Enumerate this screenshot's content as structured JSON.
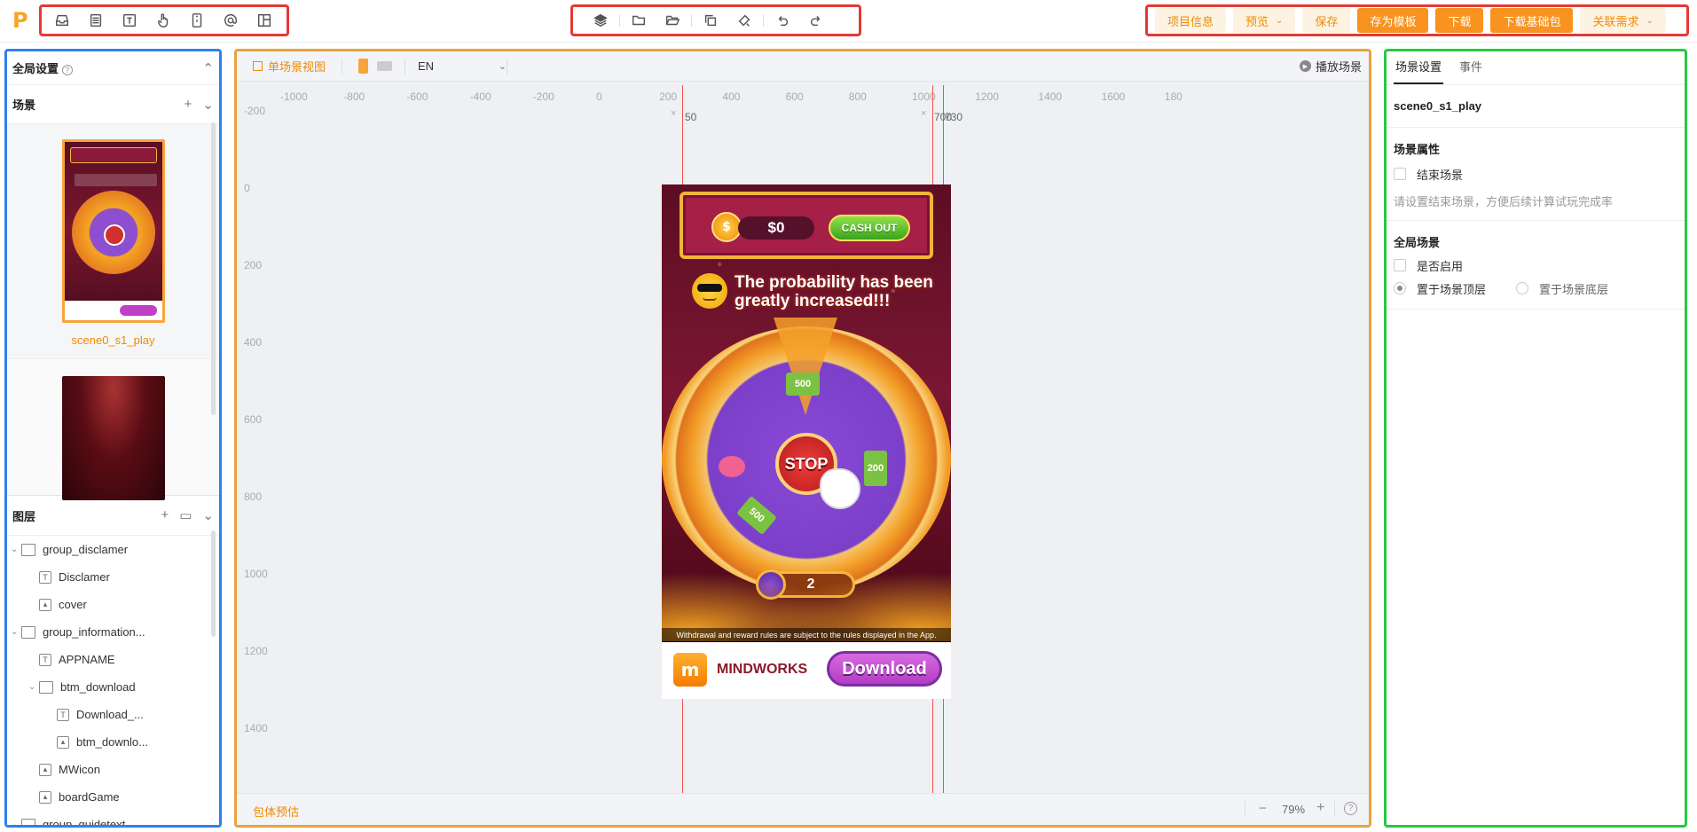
{
  "toolbar": {
    "left_icons": [
      "inbox-icon",
      "list-icon",
      "text-icon",
      "hand-pointer-icon",
      "phone-icon",
      "at-sign-icon",
      "layout-icon"
    ],
    "center_icons": [
      "layers-icon",
      "folder-icon",
      "folder-open-icon",
      "copy-icon",
      "paint-icon",
      "undo-icon",
      "redo-icon"
    ],
    "buttons": {
      "project_info": "项目信息",
      "preview": "预览",
      "save": "保存",
      "save_template": "存为模板",
      "download": "下载",
      "download_base": "下载基础包",
      "related": "关联需求"
    }
  },
  "left_panel": {
    "global_settings": "全局设置",
    "scenes_title": "场景",
    "scenes": [
      {
        "name": "scene0_s1_play",
        "selected": true
      },
      {
        "name": "",
        "selected": false
      }
    ],
    "layers_title": "图层",
    "layers": [
      {
        "name": "group_disclamer",
        "type": "folder",
        "depth": 0
      },
      {
        "name": "Disclamer",
        "type": "text",
        "depth": 1
      },
      {
        "name": "cover",
        "type": "image",
        "depth": 1
      },
      {
        "name": "group_information...",
        "type": "folder",
        "depth": 0
      },
      {
        "name": "APPNAME",
        "type": "text",
        "depth": 1
      },
      {
        "name": "btm_download",
        "type": "folder",
        "depth": 1
      },
      {
        "name": "Download_...",
        "type": "text",
        "depth": 2
      },
      {
        "name": "btm_downlo...",
        "type": "image",
        "depth": 2
      },
      {
        "name": "MWicon",
        "type": "image",
        "depth": 1
      },
      {
        "name": "boardGame",
        "type": "image",
        "depth": 1
      },
      {
        "name": "group_guidetext",
        "type": "folder",
        "depth": 0
      }
    ]
  },
  "canvas": {
    "view_label": "单场景视图",
    "language": "EN",
    "play_scene": "播放场景",
    "ruler_x": [
      "-1000",
      "-800",
      "-600",
      "-400",
      "-200",
      "0",
      "200",
      "400",
      "600",
      "800",
      "1000",
      "1200",
      "1400",
      "1600",
      "180"
    ],
    "ruler_y": [
      "-200",
      "0",
      "200",
      "400",
      "600",
      "800",
      "1000",
      "1200",
      "1400"
    ],
    "guide_labels": [
      "50",
      "700",
      "730"
    ],
    "package_estimate": "包体预估",
    "zoom": "79%",
    "zoom_minus": "−",
    "zoom_plus": "+",
    "help": "?"
  },
  "game": {
    "balance": "$0",
    "cash_out": "CASH OUT",
    "headline": "The probability has been greatly increased!!!",
    "stop": "STOP",
    "spins": "2",
    "disclaimer": "Withdrawal and reward rules are subject to the rules displayed in the App.",
    "app_name": "MINDWORKS",
    "download": "Download",
    "wheel_values": [
      "500",
      "200",
      "500"
    ]
  },
  "right_panel": {
    "tabs": [
      "场景设置",
      "事件"
    ],
    "active_tab": 0,
    "scene_name": "scene0_s1_play",
    "scene_props_title": "场景属性",
    "end_scene": "结束场景",
    "end_scene_hint": "请设置结束场景，方便后续计算试玩完成率",
    "global_scene_title": "全局场景",
    "enable": "是否启用",
    "top_layer": "置于场景顶层",
    "bottom_layer": "置于场景底层"
  },
  "colors": {
    "accent": "#f7931e",
    "accent_light": "#fdf3e3",
    "highlight_red": "#e53935",
    "panel_blue": "#2f80ed",
    "panel_orange": "#e8a33d",
    "panel_green": "#27c93f"
  }
}
